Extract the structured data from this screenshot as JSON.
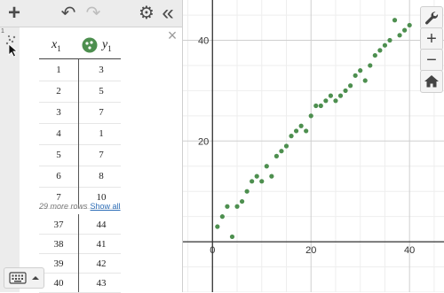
{
  "toolbar": {
    "add_label": "+",
    "undo_label": "↶",
    "redo_label": "↷",
    "settings_label": "⚙",
    "collapse_label": "«"
  },
  "expression_list": {
    "gutter_number": "1"
  },
  "table": {
    "col1_var": "x",
    "col1_sub": "1",
    "col2_var": "y",
    "col2_sub": "1",
    "series_color": "#4d8f4f",
    "top_rows": [
      [
        "1",
        "3"
      ],
      [
        "2",
        "5"
      ],
      [
        "3",
        "7"
      ],
      [
        "4",
        "1"
      ],
      [
        "5",
        "7"
      ],
      [
        "6",
        "8"
      ],
      [
        "7",
        "10"
      ]
    ],
    "more_rows_text": "29 more rows",
    "show_all_label": "Show all",
    "bottom_rows": [
      [
        "37",
        "44"
      ],
      [
        "38",
        "41"
      ],
      [
        "39",
        "42"
      ],
      [
        "40",
        "43"
      ]
    ]
  },
  "graph": {
    "x_tick_labels": [
      "0",
      "20",
      "40"
    ],
    "y_tick_labels": [
      "20",
      "40"
    ],
    "point_color": "#4d8f4f",
    "icons": [
      "wrench-icon",
      "zoom-in-icon",
      "zoom-out-icon",
      "home-icon"
    ],
    "zoom_in_label": "+",
    "zoom_out_label": "−"
  },
  "chart_data": {
    "type": "scatter",
    "title": "",
    "xlabel": "",
    "ylabel": "",
    "xlim": [
      -6,
      47
    ],
    "ylim": [
      -10,
      48
    ],
    "x": [
      1,
      2,
      3,
      4,
      5,
      6,
      7,
      8,
      9,
      10,
      11,
      12,
      13,
      14,
      15,
      16,
      17,
      18,
      19,
      20,
      21,
      22,
      23,
      24,
      25,
      26,
      27,
      28,
      29,
      30,
      31,
      32,
      33,
      34,
      35,
      36,
      37,
      38,
      39,
      40
    ],
    "y": [
      3,
      5,
      7,
      1,
      7,
      8,
      10,
      12,
      13,
      12,
      15,
      13,
      17,
      18,
      19,
      21,
      22,
      23,
      22,
      25,
      27,
      27,
      28,
      29,
      28,
      29,
      30,
      31,
      33,
      34,
      32,
      35,
      37,
      38,
      39,
      40,
      44,
      41,
      42,
      43
    ]
  }
}
